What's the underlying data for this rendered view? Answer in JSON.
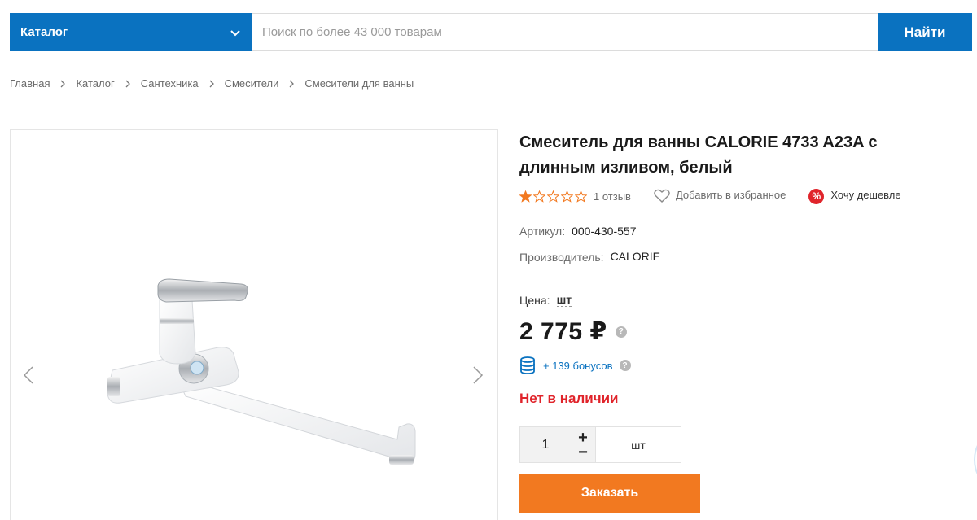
{
  "header": {
    "catalog_label": "Каталог",
    "search_placeholder": "Поиск по более 43 000 товарам",
    "search_value": "",
    "find_label": "Найти"
  },
  "breadcrumb": [
    "Главная",
    "Каталог",
    "Сантехника",
    "Смесители",
    "Смесители для ванны"
  ],
  "product": {
    "title_line1": "Смеситель для ванны CALORIE 4733 A23A с",
    "title_line2": "длинным изливом, белый",
    "rating": 1,
    "rating_max": 5,
    "reviews": "1 отзыв",
    "favorite_label": "Добавить в избранное",
    "cheaper_label": "Хочу дешевле",
    "article_label": "Артикул:",
    "article_value": "000-430-557",
    "manufacturer_label": "Производитель:",
    "manufacturer_value": "CALORIE",
    "price_label": "Цена:",
    "price_unit": "шт",
    "price": "2 775 ₽",
    "bonus": "+ 139 бонусов",
    "stock_status": "Нет в наличии",
    "quantity": "1",
    "quantity_unit": "шт",
    "order_label": "Заказать"
  },
  "colors": {
    "brand_blue": "#0a72c0",
    "order_orange": "#f27920",
    "alert_red": "#e0242b",
    "star_orange": "#f27920"
  },
  "icons": {
    "catalog_chevron": "chevron-down-icon",
    "breadcrumb_separator": "chevron-right-icon",
    "favorite": "heart-icon",
    "cheaper": "percent-badge-icon",
    "bonus": "coins-stack-icon",
    "gallery_prev": "chevron-left-icon",
    "gallery_next": "chevron-right-icon"
  }
}
